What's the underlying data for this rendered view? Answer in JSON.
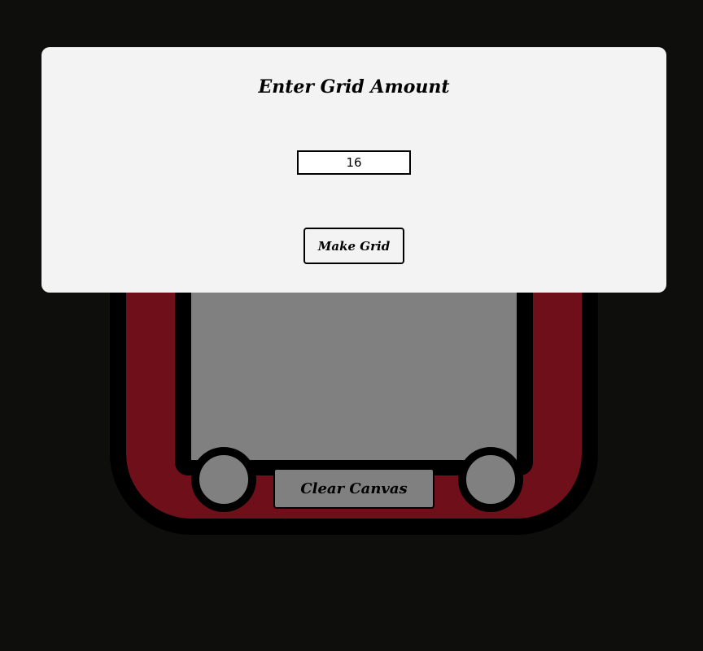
{
  "modal": {
    "title": "Enter Grid Amount",
    "grid_amount_value": "16",
    "make_grid_label": "Make Grid"
  },
  "toy": {
    "clear_label": "Clear Canvas"
  },
  "colors": {
    "page_background": "#0e0e0d",
    "toy_body": "#6e0f1a",
    "toy_outline": "#000000",
    "screen": "#808080",
    "modal_background": "#f3f3f3"
  }
}
